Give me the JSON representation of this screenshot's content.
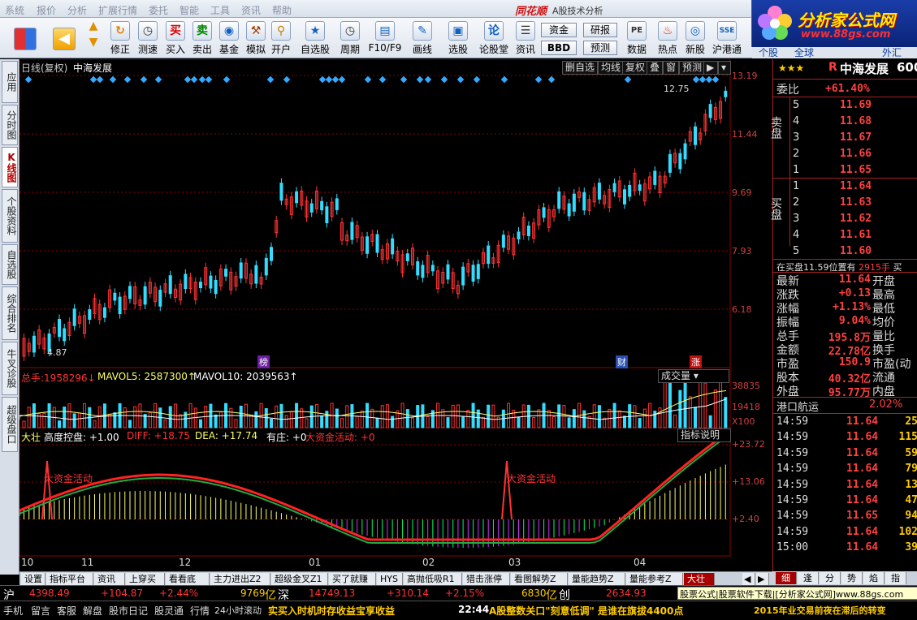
{
  "menu": [
    "系统",
    "报价",
    "分析",
    "扩展行情",
    "委托",
    "智能",
    "工具",
    "资讯",
    "帮助"
  ],
  "brand": "同花顺",
  "window_title": "A股技术分析",
  "logo": {
    "text": "分析家公式网",
    "url": "www.88gs.com"
  },
  "toolbar": {
    "buttons": [
      "修正",
      "测速",
      "买入",
      "卖出",
      "基金",
      "模拟",
      "开户",
      "自选股",
      "周期",
      "F10/F9",
      "画线",
      "选股",
      "论股堂",
      "资讯",
      "数据",
      "热点",
      "新股",
      "沪港通"
    ],
    "boxes": [
      "资金",
      "研报",
      "BBD",
      "预测"
    ],
    "extra": [
      "个股",
      "全球",
      "外汇"
    ]
  },
  "left_tabs": [
    "应用",
    "分时图",
    "K线图",
    "个股资料",
    "自选股",
    "综合排名",
    "牛叉诊股",
    "超级盘口"
  ],
  "chart": {
    "period_label": "日线(复权)",
    "stock_name": "中海发展",
    "buttons": [
      "删自选",
      "均线",
      "复权",
      "叠",
      "窗",
      "预测"
    ],
    "price_ticks": [
      "13.19",
      "11.44",
      "9.69",
      "7.93",
      "6.18"
    ],
    "high_label": "12.75",
    "low_label": "4.87",
    "markers": [
      "榜",
      "财",
      "涨"
    ],
    "volume": {
      "total_label": "总手:",
      "total": "1958296",
      "ma5_label": "MAVOL5:",
      "ma5": "2587300",
      "ma10_label": "MAVOL10:",
      "ma10": "2039563",
      "dropdown": "成交量",
      "ticks": [
        "38835",
        "19418",
        "X100"
      ]
    },
    "indicator": {
      "name": "大壮",
      "text1": "高度控盘: +1.00",
      "text2": "DIFF: +18.75",
      "text3": "DEA: +17.74",
      "text4": "有庄: +0",
      "text5": "大资金活动: +0",
      "button": "指标说明",
      "ticks": [
        "+23.72",
        "+13.06",
        "+2.40"
      ],
      "annotation": "大资金活动"
    },
    "x_ticks": [
      "10",
      "11",
      "12",
      "01",
      "02",
      "03",
      "04"
    ]
  },
  "quote": {
    "code_prefix": "R",
    "name": "中海发展",
    "code": "600",
    "weibi_label": "委比",
    "weibi": "+61.40%",
    "sell_label": "卖盘",
    "sell": [
      {
        "lvl": "5",
        "price": "11.69"
      },
      {
        "lvl": "4",
        "price": "11.68"
      },
      {
        "lvl": "3",
        "price": "11.67"
      },
      {
        "lvl": "2",
        "price": "11.66"
      },
      {
        "lvl": "1",
        "price": "11.65"
      }
    ],
    "buy_label": "买盘",
    "buy": [
      {
        "lvl": "1",
        "price": "11.64"
      },
      {
        "lvl": "2",
        "price": "11.63"
      },
      {
        "lvl": "3",
        "price": "11.62"
      },
      {
        "lvl": "4",
        "price": "11.61"
      },
      {
        "lvl": "5",
        "price": "11.60"
      }
    ],
    "notice": "在买盘11.59位置有",
    "notice_val": "2915手",
    "notice_tail": "买",
    "stats": [
      {
        "l": "最新",
        "v": "11.64",
        "r": "开盘"
      },
      {
        "l": "涨跌",
        "v": "+0.13",
        "r": "最高"
      },
      {
        "l": "涨幅",
        "v": "+1.13%",
        "r": "最低"
      },
      {
        "l": "振幅",
        "v": "9.04%",
        "r": "均价"
      },
      {
        "l": "总手",
        "v": "195.8万",
        "r": "量比"
      },
      {
        "l": "金额",
        "v": "22.78亿",
        "r": "换手"
      },
      {
        "l": "市盈",
        "v": "150.9",
        "r": "市盈(动"
      },
      {
        "l": "股本",
        "v": "40.32亿",
        "r": "流通"
      },
      {
        "l": "外盘",
        "v": "95.77万",
        "r": "内盘"
      }
    ],
    "sector": "港口航运",
    "sector_pct": "2.02%",
    "ticks": [
      {
        "t": "14:59",
        "p": "11.64",
        "v": "25"
      },
      {
        "t": "14:59",
        "p": "11.64",
        "v": "115"
      },
      {
        "t": "14:59",
        "p": "11.64",
        "v": "59"
      },
      {
        "t": "14:59",
        "p": "11.64",
        "v": "79"
      },
      {
        "t": "14:59",
        "p": "11.64",
        "v": "13"
      },
      {
        "t": "14:59",
        "p": "11.64",
        "v": "47"
      },
      {
        "t": "14:59",
        "p": "11.65",
        "v": "94"
      },
      {
        "t": "14:59",
        "p": "11.64",
        "v": "102"
      },
      {
        "t": "15:00",
        "p": "11.64",
        "v": "39"
      }
    ],
    "promo": "股票公式|股票软件下载|[分析家公式网]www.88gs.com"
  },
  "bottom_tabs": [
    "设置",
    "指标平台",
    "资讯",
    "上穿买",
    "看看底",
    "主力进出Z2",
    "超级金叉Z1",
    "买了就赚",
    "HYS",
    "高抛低吸R1",
    "猎击涨停",
    "看图解势Z",
    "量能趋势Z",
    "量能参考Z",
    "大壮"
  ],
  "right_tabs": [
    "细",
    "逢",
    "分",
    "势",
    "焰",
    "指"
  ],
  "status1": {
    "sh_label": "沪",
    "sh_index": "4398.49",
    "sh_chg": "+104.87",
    "sh_pct": "+2.44%",
    "sh_amt": "9769",
    "sh_unit": "亿",
    "sz_label": "深",
    "sz_index": "14749.13",
    "sz_chg": "+310.14",
    "sz_pct": "+2.15%",
    "sz_amt": "6830",
    "sz_unit": "亿",
    "cy_label": "创",
    "cy_index": "2634.93"
  },
  "status2": {
    "items": [
      "手机",
      "留言",
      "客服",
      "解盘",
      "股市日记",
      "股灵通",
      "行情",
      "24小时滚动"
    ],
    "news1": "实买入时机时存收益宝享收益",
    "time": "22:44",
    "news2": "A股整数关口\"刻意低调\" 是谁在旗拔4400点",
    "news3": "2015年业交易前夜在滞后的转变"
  },
  "colors": {
    "up": "#ff3333",
    "down": "#33ddff",
    "grid": "#8b0000",
    "accent": "#b00000"
  }
}
